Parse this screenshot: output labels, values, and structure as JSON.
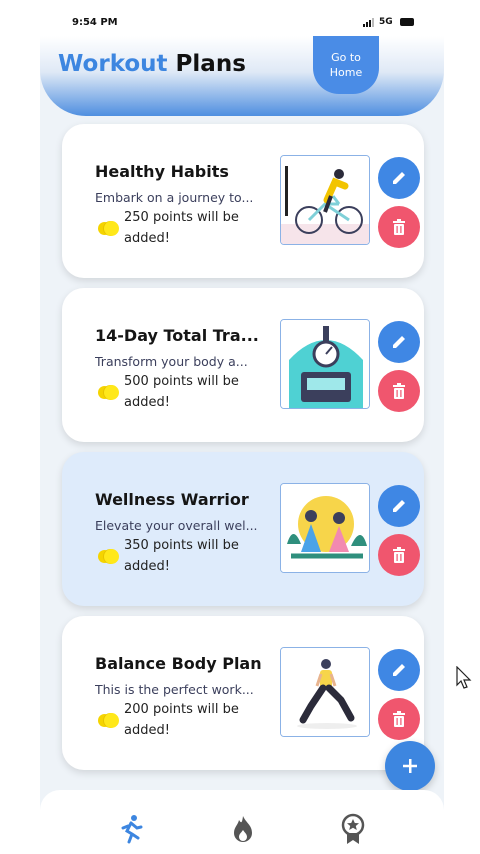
{
  "status_bar": {
    "time": "9:54 PM",
    "network": "5G"
  },
  "header": {
    "title_part1": "Workout",
    "title_part2": " Plans",
    "home_button_label_line1": "Go to",
    "home_button_label_line2": "Home"
  },
  "plans": [
    {
      "title": "Healthy Habits",
      "description": "Embark on a journey to...",
      "points_line1": "250 points will be",
      "points_line2": "added!",
      "image_icon": "cyclist-illustration"
    },
    {
      "title": "14-Day Total Tra...",
      "description": "Transform your body a...",
      "points_line1": "500 points will be",
      "points_line2": "added!",
      "image_icon": "scale-illustration"
    },
    {
      "title": "Wellness Warrior",
      "description": "Elevate your overall wel...",
      "points_line1": "350 points will be",
      "points_line2": "added!",
      "image_icon": "meditation-illustration"
    },
    {
      "title": "Balance Body Plan",
      "description": "This is the perfect work...",
      "points_line1": "200 points will be",
      "points_line2": "added!",
      "image_icon": "lunge-illustration"
    }
  ],
  "bottom_nav": [
    {
      "icon": "running-icon",
      "active": true
    },
    {
      "icon": "fire-icon",
      "active": false
    },
    {
      "icon": "award-badge-icon",
      "active": false
    }
  ],
  "colors": {
    "accent": "#3d86e0",
    "delete": "#f0566e",
    "coin": "#ffe81a",
    "highlight_card": "#deebfb"
  }
}
